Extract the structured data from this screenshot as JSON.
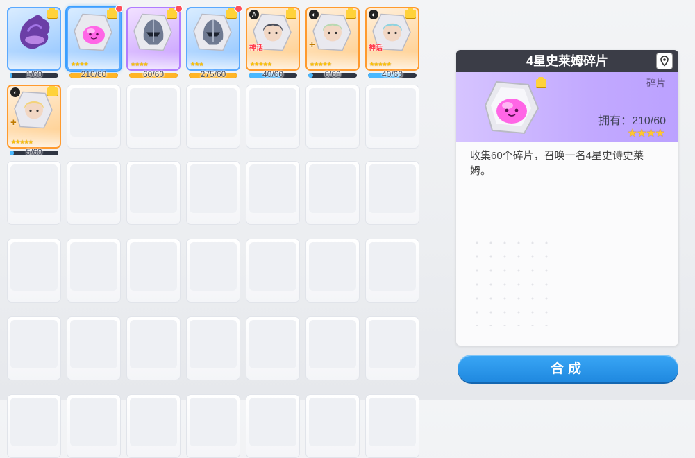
{
  "panel": {
    "title": "4星史莱姆碎片",
    "type_label": "碎片",
    "owned_label": "拥有",
    "owned_value": "210/60",
    "stars": "★★★★",
    "description": "收集60个碎片，召唤一名4星史诗史莱姆。"
  },
  "compose_button": "合成",
  "colors": {
    "accent_blue": "#1f88df",
    "panel_header": "#3b3d47",
    "rarity_purple": "#c2a9ff",
    "rarity_orange": "#ff9a2e",
    "rarity_blue": "#5aa9ff"
  },
  "shards": [
    {
      "name": "purple-dragon",
      "rarity": "blue",
      "count": "1/60",
      "progress": 0.017,
      "selected": false,
      "red_dot": false,
      "stars": "",
      "tag": "",
      "class_icon": "",
      "icon": "dragon-icon"
    },
    {
      "name": "slime",
      "rarity": "blue",
      "count": "210/60",
      "progress": 1.0,
      "selected": true,
      "red_dot": true,
      "stars": "★★★★",
      "tag": "",
      "class_icon": "",
      "icon": "slime-icon"
    },
    {
      "name": "knight-helmet-purple",
      "rarity": "purple",
      "count": "60/60",
      "progress": 1.0,
      "selected": false,
      "red_dot": true,
      "stars": "★★★★",
      "tag": "",
      "class_icon": "",
      "icon": "helmet-icon"
    },
    {
      "name": "knight-helmet-blue",
      "rarity": "blue",
      "count": "275/60",
      "progress": 1.0,
      "selected": false,
      "red_dot": true,
      "stars": "★★★",
      "tag": "",
      "class_icon": "",
      "icon": "helmet-icon"
    },
    {
      "name": "hero-dark",
      "rarity": "orange",
      "count": "40/60",
      "progress": 0.667,
      "selected": false,
      "red_dot": false,
      "stars": "★★★★★",
      "tag": "神话",
      "class_icon": "A",
      "icon": "hero-icon"
    },
    {
      "name": "hero-green",
      "rarity": "orange",
      "count": "6/60",
      "progress": 0.1,
      "selected": false,
      "red_dot": false,
      "stars": "★★★★★",
      "tag": "",
      "class_icon": "◐",
      "icon": "hero-icon",
      "plus": true
    },
    {
      "name": "hero-ice",
      "rarity": "orange",
      "count": "40/60",
      "progress": 0.667,
      "selected": false,
      "red_dot": false,
      "stars": "★★★★★",
      "tag": "神话",
      "class_icon": "◐",
      "icon": "hero-icon"
    },
    {
      "name": "hero-blonde",
      "rarity": "orange",
      "count": "5/60",
      "progress": 0.083,
      "selected": false,
      "red_dot": false,
      "stars": "★★★★★",
      "tag": "",
      "class_icon": "◐",
      "icon": "hero-icon",
      "plus": true
    }
  ]
}
